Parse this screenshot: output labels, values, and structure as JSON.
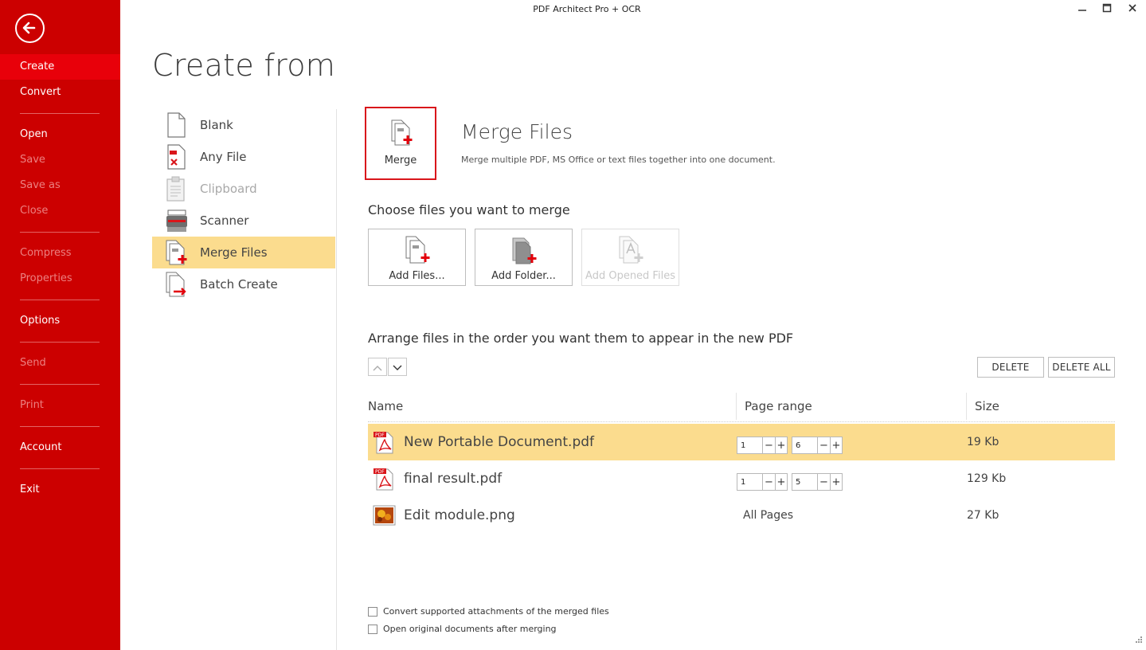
{
  "window": {
    "title": "PDF Architect Pro + OCR"
  },
  "sidebar": {
    "items": [
      {
        "label": "Create",
        "state": "active"
      },
      {
        "label": "Convert",
        "state": "normal"
      },
      {
        "label": "Open",
        "state": "normal"
      },
      {
        "label": "Save",
        "state": "disabled"
      },
      {
        "label": "Save as",
        "state": "disabled"
      },
      {
        "label": "Close",
        "state": "disabled"
      },
      {
        "label": "Compress",
        "state": "disabled"
      },
      {
        "label": "Properties",
        "state": "disabled"
      },
      {
        "label": "Options",
        "state": "normal"
      },
      {
        "label": "Send",
        "state": "disabled"
      },
      {
        "label": "Print",
        "state": "disabled"
      },
      {
        "label": "Account",
        "state": "normal"
      },
      {
        "label": "Exit",
        "state": "normal"
      }
    ]
  },
  "page": {
    "heading": "Create from"
  },
  "sources": [
    {
      "label": "Blank",
      "icon": "blank-page-icon",
      "state": "normal"
    },
    {
      "label": "Any File",
      "icon": "any-file-icon",
      "state": "normal"
    },
    {
      "label": "Clipboard",
      "icon": "clipboard-icon",
      "state": "disabled"
    },
    {
      "label": "Scanner",
      "icon": "scanner-icon",
      "state": "normal"
    },
    {
      "label": "Merge Files",
      "icon": "merge-files-icon",
      "state": "selected"
    },
    {
      "label": "Batch Create",
      "icon": "batch-create-icon",
      "state": "normal"
    }
  ],
  "merge": {
    "tile_label": "Merge",
    "title": "Merge Files",
    "description": "Merge multiple PDF, MS Office or text files together into one document.",
    "choose_label": "Choose files you want to merge",
    "add_buttons": [
      {
        "label": "Add Files...",
        "enabled": true
      },
      {
        "label": "Add Folder...",
        "enabled": true
      },
      {
        "label": "Add Opened Files",
        "enabled": false
      }
    ],
    "arrange_label": "Arrange files in the order you want them to appear in the new PDF",
    "delete_label": "DELETE",
    "delete_all_label": "DELETE ALL"
  },
  "table": {
    "columns": [
      "Name",
      "Page range",
      "Size"
    ],
    "rows": [
      {
        "name": "New Portable Document.pdf",
        "type": "pdf",
        "range_from": "1",
        "range_to": "6",
        "range_text": "",
        "size": "19 Kb",
        "selected": true
      },
      {
        "name": "final result.pdf",
        "type": "pdf",
        "range_from": "1",
        "range_to": "5",
        "range_text": "",
        "size": "129 Kb",
        "selected": false
      },
      {
        "name": "Edit module.png",
        "type": "png",
        "range_from": "",
        "range_to": "",
        "range_text": "All Pages",
        "size": "27 Kb",
        "selected": false
      }
    ]
  },
  "options": {
    "convert_attachments": "Convert supported attachments of the merged files",
    "open_original": "Open original documents after merging"
  },
  "colors": {
    "brand_red": "#cc0000",
    "active_red": "#e8000a",
    "selection": "#fbdc8e",
    "accent": "#d9161b"
  }
}
